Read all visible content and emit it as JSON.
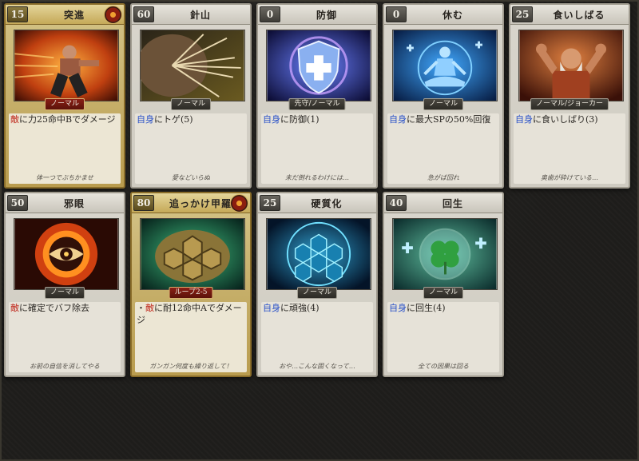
{
  "cards": [
    {
      "cost": "15",
      "name": "突進",
      "tag": "ノーマル",
      "desc_pre": "",
      "desc_target": "敵",
      "desc_rest": "に力25命中Bでダメージ",
      "flavor": "体一つでぶちかませ"
    },
    {
      "cost": "60",
      "name": "針山",
      "tag": "ノーマル",
      "desc_pre": "",
      "desc_target": "自身",
      "desc_rest": "にトゲ(5)",
      "flavor": "愛などいらぬ"
    },
    {
      "cost": "0",
      "name": "防御",
      "tag": "先守/ノーマル",
      "desc_pre": "",
      "desc_target": "自身",
      "desc_rest": "に防御(1)",
      "flavor": "未だ倒れるわけには…"
    },
    {
      "cost": "0",
      "name": "休む",
      "tag": "ノーマル",
      "desc_pre": "",
      "desc_target": "自身",
      "desc_rest": "に最大SPの50%回復",
      "flavor": "急がば回れ"
    },
    {
      "cost": "25",
      "name": "食いしばる",
      "tag": "ノーマル/ジョーカー",
      "desc_pre": "",
      "desc_target": "自身",
      "desc_rest": "に食いしばり(3)",
      "flavor": "奥歯が砕けている…"
    },
    {
      "cost": "50",
      "name": "邪眼",
      "tag": "ノーマル",
      "desc_pre": "",
      "desc_target": "敵",
      "desc_rest": "に確定でバフ除去",
      "flavor": "お前の自信を消してやる"
    },
    {
      "cost": "80",
      "name": "追っかけ甲羅",
      "tag": "ループ2-5",
      "desc_pre": "・",
      "desc_target": "敵",
      "desc_rest": "に耐12命中Aでダメージ",
      "flavor": "ガンガン何度も繰り返して！"
    },
    {
      "cost": "25",
      "name": "硬質化",
      "tag": "ノーマル",
      "desc_pre": "",
      "desc_target": "自身",
      "desc_rest": "に頑強(4)",
      "flavor": "おや…こんな固くなって…"
    },
    {
      "cost": "40",
      "name": "回生",
      "tag": "ノーマル",
      "desc_pre": "",
      "desc_target": "自身",
      "desc_rest": "に回生(4)",
      "flavor": "全ての因果は回る"
    }
  ],
  "colors": {
    "enemy": "#c0281c",
    "self": "#2850c8",
    "gold_frame": "#b99c4e",
    "gray_frame": "#cfcbc1"
  }
}
